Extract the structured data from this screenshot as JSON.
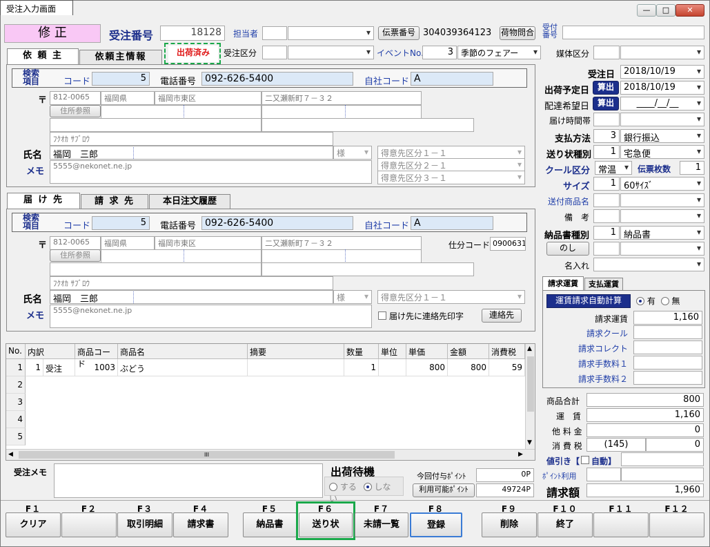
{
  "window": {
    "tab_title": "受注入力画面",
    "min": "—",
    "max": "□",
    "close": "✕"
  },
  "header": {
    "mode": "修 正",
    "order_no_label": "受注番号",
    "order_no": "18128",
    "staff_label": "担当者",
    "voucher_btn": "伝票番号",
    "voucher_no": "304039364123",
    "inquiry_btn": "荷物問合",
    "receipt_label_1": "受付",
    "receipt_label_2": "番号",
    "order_kind_label": "受注区分",
    "event_label": "イベントNo.",
    "event_no": "3",
    "event_name": "季節のフェアー",
    "media_label": "媒体区分",
    "shipped_badge": "出荷済み"
  },
  "client_tabs": [
    "依 頼 主",
    "依頼主情報"
  ],
  "client": {
    "search_1": "検索",
    "search_2": "項目",
    "code_label": "コード",
    "code": "5",
    "phone_label": "電話番号",
    "phone": "092-626-5400",
    "own_code_label": "自社コード",
    "own_code": "A",
    "postal_mark": "〒",
    "zip": "812-0065",
    "pref": "福岡県",
    "city": "福岡市東区",
    "street": "二又瀬新町７－３２",
    "address_btn": "住所参照",
    "kana": "ﾌｸｵｶ ｻﾌﾞﾛｳ",
    "name_label": "氏名",
    "name": "福岡　三郎",
    "honorific": "様",
    "memo_label": "メモ",
    "email": "5555@nekonet.ne.jp",
    "cust_cat_1": "得意先区分１－１",
    "cust_cat_2": "得意先区分２－１",
    "cust_cat_3": "得意先区分３－１"
  },
  "dest_tabs": [
    "届 け 先",
    "請 求 先",
    "本日注文履歴"
  ],
  "dest": {
    "search_1": "検索",
    "search_2": "項目",
    "code_label": "コード",
    "code": "5",
    "phone_label": "電話番号",
    "phone": "092-626-5400",
    "own_code_label": "自社コード",
    "own_code": "A",
    "postal_mark": "〒",
    "zip": "812-0065",
    "pref": "福岡県",
    "city": "福岡市東区",
    "street": "二又瀬新町７－３２",
    "sort_code_label": "仕分コード",
    "sort_code": "0900631",
    "address_btn": "住所参照",
    "kana": "ﾌｸｵｶ ｻﾌﾞﾛｳ",
    "name_label": "氏名",
    "name": "福岡　三郎",
    "honorific": "様",
    "memo_label": "メモ",
    "email": "5555@nekonet.ne.jp",
    "cust_cat_1": "得意先区分１－１",
    "print_contact_label": "届け先に連絡先印字",
    "contact_btn": "連絡先"
  },
  "right": {
    "order_date_label": "受注日",
    "order_date": "2018/10/19",
    "ship_date_label": "出荷予定日",
    "calc_btn": "算出",
    "ship_date": "2018/10/19",
    "delivery_label": "配達希望日",
    "delivery_date": "____/__/__",
    "time_label": "届け時間帯",
    "pay_label": "支払方法",
    "pay_code": "3",
    "pay_name": "銀行振込",
    "slip_label": "送り状種別",
    "slip_code": "1",
    "slip_name": "宅急便",
    "cool_label": "クール区分",
    "cool_value": "常温",
    "slip_count_label": "伝票枚数",
    "slip_count": "1",
    "size_label": "サイズ",
    "size_code": "1",
    "size_name": "60ｻｲｽﾞ",
    "product_label": "送付商品名",
    "note_label": "備　考",
    "invoice_kind_label": "納品書種別",
    "invoice_kind_code": "1",
    "invoice_kind_name": "納品書",
    "noshi_btn": "のし",
    "name_print_label": "名入れ"
  },
  "fee_tabs": [
    "請求運賃",
    "支払運賃"
  ],
  "fee": {
    "auto_btn": "運賃請求自動計算",
    "yes": "有",
    "no": "無",
    "freight_label": "請求運賃",
    "freight": "1,160",
    "cool_label": "請求クール",
    "collect_label": "請求コレクト",
    "fee1_label": "請求手数料１",
    "fee2_label": "請求手数料２"
  },
  "totals": {
    "goods_label": "商品合計",
    "goods": "800",
    "freight_label": "運　賃",
    "freight": "1,160",
    "other_label": "他 料 金",
    "other": "0",
    "tax_label": "消 費 税",
    "tax_paren": "(145)",
    "tax": "0",
    "discount_label": "値引き【",
    "auto_label": "自動】",
    "point_label": "ﾎﾟｲﾝﾄ利用",
    "bill_label": "請求額",
    "bill": "1,960"
  },
  "grid": {
    "headers": [
      "No.",
      "内訳",
      "商品コード",
      "商品名",
      "摘要",
      "数量",
      "単位",
      "単価",
      "金額",
      "消費税"
    ],
    "row1": [
      "1",
      "1",
      "受注",
      "1003",
      "ぶどう",
      "",
      "1",
      "",
      "800",
      "800",
      "59"
    ],
    "row_numbers": [
      "2",
      "3",
      "4",
      "5"
    ],
    "scroll_mark": "III"
  },
  "bottom": {
    "memo_label": "受注メモ",
    "standby_title": "出荷待機",
    "standby_yes": "する",
    "standby_no": "しない",
    "points_given_label": "今回付与ﾎﾟｲﾝﾄ",
    "points_given": "0P",
    "points_avail_btn": "利用可能ﾎﾟｲﾝﾄ",
    "points_avail": "49724P"
  },
  "fkeys": [
    {
      "key": "F１",
      "label": "クリア"
    },
    {
      "key": "F２",
      "label": ""
    },
    {
      "key": "F３",
      "label": "取引明細"
    },
    {
      "key": "F４",
      "label": "請求書"
    },
    {
      "key": "F５",
      "label": "納品書"
    },
    {
      "key": "F６",
      "label": "送り状"
    },
    {
      "key": "F７",
      "label": "未請一覧"
    },
    {
      "key": "F８",
      "label": "登録"
    },
    {
      "key": "F９",
      "label": "削除"
    },
    {
      "key": "F１０",
      "label": "終了"
    },
    {
      "key": "F１１",
      "label": ""
    },
    {
      "key": "F１２",
      "label": ""
    }
  ],
  "colors": {
    "mode_bg": "#f9c8f5",
    "navy": "#1c2f8c",
    "highlight_green": "#1aa84a",
    "badge_red": "#e01818"
  }
}
